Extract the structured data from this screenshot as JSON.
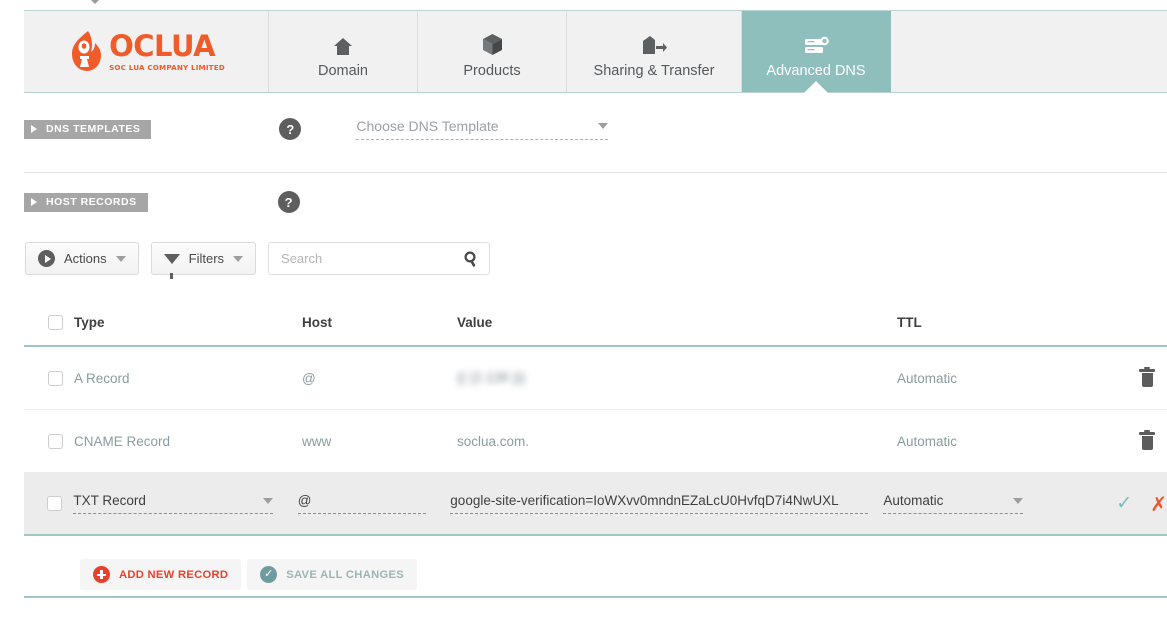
{
  "brand": {
    "name": "OCLUA",
    "tagline": "SOC LUA COMPANY LIMITED",
    "color": "#f15a29"
  },
  "nav": {
    "tabs": [
      {
        "label": "Domain",
        "icon": "home-icon",
        "active": false
      },
      {
        "label": "Products",
        "icon": "box-icon",
        "active": false
      },
      {
        "label": "Sharing & Transfer",
        "icon": "share-transfer-icon",
        "active": false
      },
      {
        "label": "Advanced DNS",
        "icon": "dns-server-icon",
        "active": true
      }
    ],
    "active_color": "#8fbfbd"
  },
  "sections": {
    "dns_templates": {
      "label": "DNS TEMPLATES",
      "help": "?",
      "select_value": "Choose DNS Template"
    },
    "host_records": {
      "label": "HOST RECORDS",
      "help": "?"
    }
  },
  "toolbar": {
    "actions_label": "Actions",
    "filters_label": "Filters",
    "search_value": "",
    "search_placeholder": "Search"
  },
  "table": {
    "columns": [
      "Type",
      "Host",
      "Value",
      "TTL"
    ],
    "rows": [
      {
        "type": "A Record",
        "host": "@",
        "value": "(( (2.128 )))",
        "value_blurred": true,
        "ttl": "Automatic",
        "editing": false,
        "action": "delete"
      },
      {
        "type": "CNAME Record",
        "host": "www",
        "value": "soclua.com.",
        "value_blurred": false,
        "ttl": "Automatic",
        "editing": false,
        "action": "delete"
      },
      {
        "type": "TXT Record",
        "host": "@",
        "value": "google-site-verification=IoWXvv0mndnEZaLcU0HvfqD7i4NwUXL",
        "value_blurred": false,
        "ttl": "Automatic",
        "editing": true,
        "action": "confirm-cancel"
      }
    ]
  },
  "footer": {
    "add_label": "ADD NEW RECORD",
    "save_label": "SAVE ALL CHANGES",
    "add_color": "#e8402a",
    "save_color": "#6f9c9e"
  }
}
